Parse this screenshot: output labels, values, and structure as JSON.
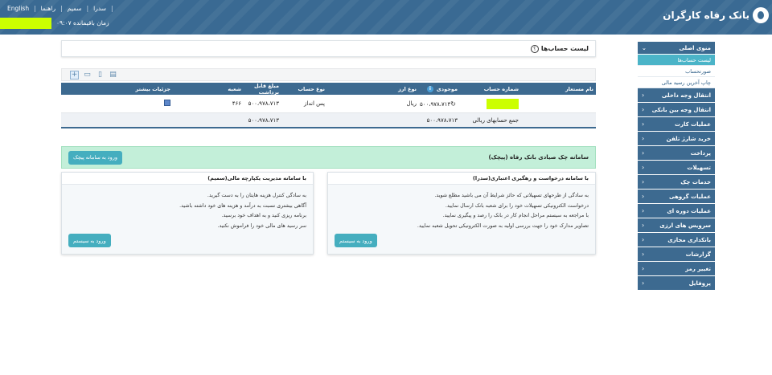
{
  "header": {
    "brand": "بانک رفاه کارگران",
    "links": [
      "English",
      "راهنما",
      "سمیم",
      "سدرا"
    ],
    "session_label": "زمان باقیمانده ۰۹:۰۷"
  },
  "sidebar": {
    "main_menu": "منوی اصلی",
    "sub_items": [
      "لیست حساب‌ها",
      "صورتحساب",
      "چاپ آخرین رسید مالی"
    ],
    "items": [
      "انتقال وجه داخلی",
      "انتقال وجه بین بانکی",
      "عملیات کارت",
      "خرید شارژ تلفن",
      "پرداخت",
      "تسهیلات",
      "خدمات چک",
      "عملیات گروهی",
      "عملیات دوره ای",
      "سرویس های ارزی",
      "بانکداری مجازی",
      "گزارشات",
      "تغییر رمز",
      "پروفایل"
    ]
  },
  "page": {
    "title": "لیست حساب‌ها",
    "help_glyph": "؟"
  },
  "table": {
    "headers": [
      "نام مستعار",
      "شماره حساب",
      "موجودی",
      "نوع ارز",
      "نوع حساب",
      "مبلغ قابل برداشت",
      "شعبه",
      "جزئیات بیشتر"
    ],
    "row": {
      "balance": "۵۰۰،۹۷۸،۷۱۳",
      "currency": "ریال",
      "account_type": "پس انداز",
      "withdrawable": "۵۰۰،۹۷۸،۷۱۳",
      "branch": "۴۶۶"
    },
    "summary": {
      "label": "جمع حسابهای ریالی",
      "balance": "۵۰۰،۹۷۸،۷۱۳",
      "withdrawable": "۵۰۰،۹۷۸،۷۱۳"
    }
  },
  "cheque": {
    "title": "سامانه چک صیادی بانک رفاه (پیچک)",
    "button": "ورود به سامانه پیچک"
  },
  "card_right": {
    "title": "با سامانه درخواست و رهگیری اعتباری(سدرا)",
    "lines": [
      "به سادگی از طرحهای تسهیلاتی که حائز شرایط آن می باشید مطلع شوید.",
      "درخواست الکترونیکی تسهیلات خود را برای شعبه بانک ارسال نمایید.",
      "با مراجعه به سیستم مراحل انجام کار در بانک را رصد و پیگیری نمایید.",
      "تصاویر مدارک خود را جهت بررسی اولیه به صورت الکترونیکی تحویل شعبه نمایید."
    ],
    "button": "ورود به سیستم"
  },
  "card_left": {
    "title": "با سامانه مدیریت یکپارچه مالی(سمیم)",
    "lines": [
      "به سادگی کنترل هزینه هایتان را به دست گیرید.",
      "آگاهی بیشتری نسبت به درآمد و هزینه های خود داشته باشید.",
      "برنامه ریزی کنید و به اهداف خود برسید.",
      "سر رسید های مالی خود را فراموش نکنید."
    ],
    "button": "ورود به سیستم"
  }
}
